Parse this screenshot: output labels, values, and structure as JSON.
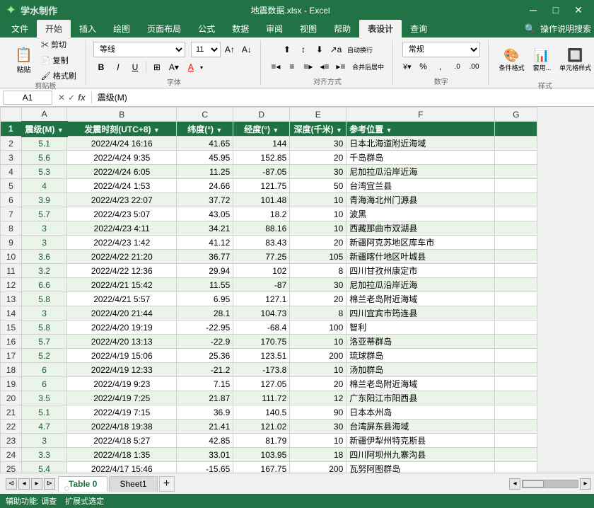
{
  "titleBar": {
    "text": "地震数据.xlsx - Excel",
    "watermark": "学水制作"
  },
  "menuBar": {
    "items": [
      "文件",
      "开始",
      "插入",
      "绘图",
      "页面布局",
      "公式",
      "数据",
      "审阅",
      "视图",
      "帮助",
      "表设计",
      "查询",
      "操作说明搜索"
    ]
  },
  "ribbonTabs": [
    "文件",
    "开始",
    "插入",
    "绘图",
    "页面布局",
    "公式",
    "数据",
    "审阅",
    "视图",
    "帮助",
    "表设计",
    "查询"
  ],
  "activeTab": "表设计",
  "fontGroup": {
    "label": "字体",
    "fontName": "等线",
    "fontSize": "11",
    "bold": "B",
    "italic": "I",
    "underline": "U"
  },
  "alignGroup": {
    "label": "对齐方式",
    "wrapText": "自动换行",
    "merge": "合并后居中"
  },
  "numberGroup": {
    "label": "数字",
    "format": "常规",
    "percent": "%",
    "comma": ","
  },
  "formulaBar": {
    "cellRef": "A1",
    "formula": "震级(M)"
  },
  "headers": {
    "a": "震级(M) ▼",
    "b": "发震时刻(UTC+8) ▼",
    "c": "纬度(°) ▼",
    "d": "经度(°) ▼",
    "e": "深度(千米) ▼",
    "f": "参考位置 ▼",
    "g": ""
  },
  "rows": [
    {
      "idx": 1,
      "a": "5.1",
      "b": "2022/4/24 16:16",
      "c": "41.65",
      "d": "144",
      "e": "30",
      "f": "日本北海道附近海域"
    },
    {
      "idx": 2,
      "a": "5.6",
      "b": "2022/4/24 9:35",
      "c": "45.95",
      "d": "152.85",
      "e": "20",
      "f": "千岛群岛"
    },
    {
      "idx": 3,
      "a": "5.3",
      "b": "2022/4/24 6:05",
      "c": "11.25",
      "d": "-87.05",
      "e": "30",
      "f": "尼加拉瓜沿岸近海"
    },
    {
      "idx": 4,
      "a": "4",
      "b": "2022/4/24 1:53",
      "c": "24.66",
      "d": "121.75",
      "e": "50",
      "f": "台湾宜兰县"
    },
    {
      "idx": 5,
      "a": "3.9",
      "b": "2022/4/23 22:07",
      "c": "37.72",
      "d": "101.48",
      "e": "10",
      "f": "青海海北州门源县"
    },
    {
      "idx": 6,
      "a": "5.7",
      "b": "2022/4/23 5:07",
      "c": "43.05",
      "d": "18.2",
      "e": "10",
      "f": "波黑"
    },
    {
      "idx": 7,
      "a": "3",
      "b": "2022/4/23 4:11",
      "c": "34.21",
      "d": "88.16",
      "e": "10",
      "f": "西藏那曲市双湖县"
    },
    {
      "idx": 8,
      "a": "3",
      "b": "2022/4/23 1:42",
      "c": "41.12",
      "d": "83.43",
      "e": "20",
      "f": "新疆阿克苏地区库车市"
    },
    {
      "idx": 9,
      "a": "3.6",
      "b": "2022/4/22 21:20",
      "c": "36.77",
      "d": "77.25",
      "e": "105",
      "f": "新疆喀什地区叶城县"
    },
    {
      "idx": 10,
      "a": "3.2",
      "b": "2022/4/22 12:36",
      "c": "29.94",
      "d": "102",
      "e": "8",
      "f": "四川甘孜州康定市"
    },
    {
      "idx": 11,
      "a": "6.6",
      "b": "2022/4/21 15:42",
      "c": "11.55",
      "d": "-87",
      "e": "30",
      "f": "尼加拉瓜沿岸近海"
    },
    {
      "idx": 12,
      "a": "5.8",
      "b": "2022/4/21 5:57",
      "c": "6.95",
      "d": "127.1",
      "e": "20",
      "f": "棉兰老岛附近海域"
    },
    {
      "idx": 13,
      "a": "3",
      "b": "2022/4/20 21:44",
      "c": "28.1",
      "d": "104.73",
      "e": "8",
      "f": "四川宜宾市筠连县"
    },
    {
      "idx": 14,
      "a": "5.8",
      "b": "2022/4/20 19:19",
      "c": "-22.95",
      "d": "-68.4",
      "e": "100",
      "f": "智利"
    },
    {
      "idx": 15,
      "a": "5.7",
      "b": "2022/4/20 13:13",
      "c": "-22.9",
      "d": "170.75",
      "e": "10",
      "f": "洛亚蒂群岛"
    },
    {
      "idx": 16,
      "a": "5.2",
      "b": "2022/4/19 15:06",
      "c": "25.36",
      "d": "123.51",
      "e": "200",
      "f": "琉球群岛"
    },
    {
      "idx": 17,
      "a": "6",
      "b": "2022/4/19 12:33",
      "c": "-21.2",
      "d": "-173.8",
      "e": "10",
      "f": "汤加群岛"
    },
    {
      "idx": 18,
      "a": "6",
      "b": "2022/4/19 9:23",
      "c": "7.15",
      "d": "127.05",
      "e": "20",
      "f": "棉兰老岛附近海域"
    },
    {
      "idx": 19,
      "a": "3.5",
      "b": "2022/4/19 7:25",
      "c": "21.87",
      "d": "111.72",
      "e": "12",
      "f": "广东阳江市阳西县"
    },
    {
      "idx": 20,
      "a": "5.1",
      "b": "2022/4/19 7:15",
      "c": "36.9",
      "d": "140.5",
      "e": "90",
      "f": "日本本州岛"
    },
    {
      "idx": 21,
      "a": "4.7",
      "b": "2022/4/18 19:38",
      "c": "21.41",
      "d": "121.02",
      "e": "30",
      "f": "台湾屏东县海域"
    },
    {
      "idx": 22,
      "a": "3",
      "b": "2022/4/18 5:27",
      "c": "42.85",
      "d": "81.79",
      "e": "10",
      "f": "新疆伊犁州特克斯县"
    },
    {
      "idx": 23,
      "a": "3.3",
      "b": "2022/4/18 1:35",
      "c": "33.01",
      "d": "103.95",
      "e": "18",
      "f": "四川阿坝州九寨沟县"
    },
    {
      "idx": 24,
      "a": "5.4",
      "b": "2022/4/17 15:46",
      "c": "-15.65",
      "d": "167.75",
      "e": "200",
      "f": "瓦努阿图群岛"
    }
  ],
  "sheets": [
    {
      "name": "Table 0",
      "active": true
    },
    {
      "name": "Sheet1",
      "active": false
    }
  ],
  "statusBar": {
    "items": [
      "辅助功能: 调查",
      "扩展式选定"
    ]
  },
  "colHeaders": [
    "A",
    "B",
    "C",
    "D",
    "E",
    "F",
    "G"
  ],
  "rowNums": [
    "1",
    "2",
    "3",
    "4",
    "5",
    "6",
    "7",
    "8",
    "9",
    "10",
    "11",
    "12",
    "13",
    "14",
    "15",
    "16",
    "17",
    "18",
    "19",
    "20",
    "21",
    "22",
    "23",
    "24",
    "25"
  ]
}
